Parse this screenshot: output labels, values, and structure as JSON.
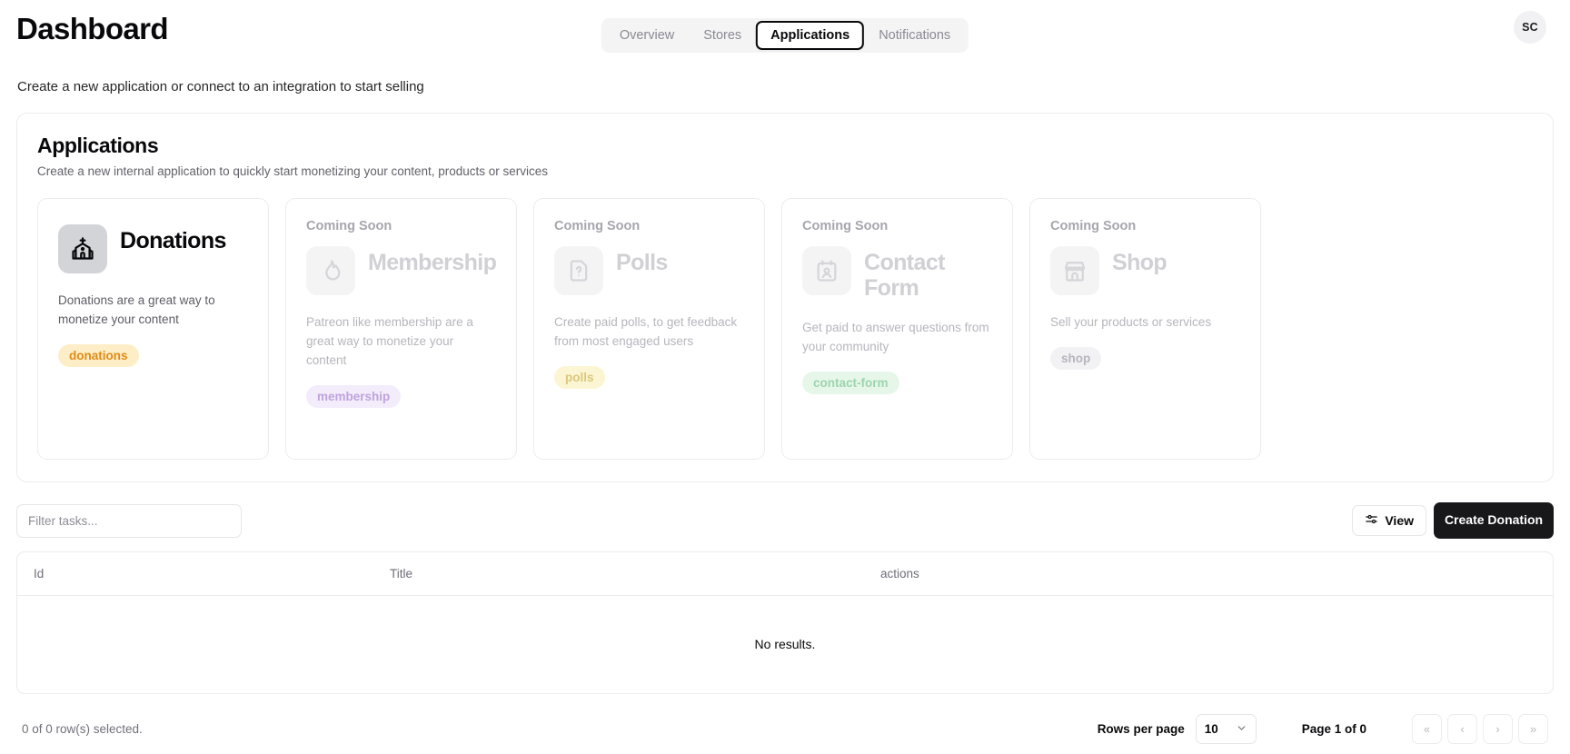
{
  "header": {
    "title": "Dashboard",
    "avatar_initials": "SC",
    "tabs": [
      {
        "label": "Overview",
        "active": false
      },
      {
        "label": "Stores",
        "active": false
      },
      {
        "label": "Applications",
        "active": true
      },
      {
        "label": "Notifications",
        "active": false
      }
    ]
  },
  "subtitle": "Create a new application or connect to an integration to start selling",
  "panel": {
    "title": "Applications",
    "description": "Create a new internal application to quickly start monetizing your content, products or services",
    "coming_soon_label": "Coming Soon",
    "cards": [
      {
        "name": "Donations",
        "icon": "church-icon",
        "description": "Donations are a great way to monetize your content",
        "badge": "donations",
        "badge_bg": "#fdeec8",
        "badge_fg": "#e08b16",
        "tile_bg": "#d3d4d8",
        "coming_soon": false
      },
      {
        "name": "Membership",
        "icon": "flame-icon",
        "description": "Patreon like membership are a great way to monetize your content",
        "badge": "membership",
        "badge_bg": "#f3ecfb",
        "badge_fg": "#c0a3dd",
        "tile_bg": "#f4f4f5",
        "coming_soon": true
      },
      {
        "name": "Polls",
        "icon": "file-question-icon",
        "description": "Create paid polls, to get feedback from most engaged users",
        "badge": "polls",
        "badge_bg": "#fbf5d3",
        "badge_fg": "#dcc77a",
        "tile_bg": "#f4f4f5",
        "coming_soon": true
      },
      {
        "name": "Contact Form",
        "icon": "contact-card-icon",
        "description": "Get paid to answer questions from your community",
        "badge": "contact-form",
        "badge_bg": "#e6f7ea",
        "badge_fg": "#9dd4ae",
        "tile_bg": "#f4f4f5",
        "coming_soon": true
      },
      {
        "name": "Shop",
        "icon": "store-icon",
        "description": "Sell your products or services",
        "badge": "shop",
        "badge_bg": "#f2f2f4",
        "badge_fg": "#b5b5bd",
        "tile_bg": "#f4f4f5",
        "coming_soon": true
      }
    ]
  },
  "toolbar": {
    "filter_placeholder": "Filter tasks...",
    "filter_value": "",
    "view_label": "View",
    "view_icon": "sliders-icon",
    "create_label": "Create Donation"
  },
  "table": {
    "columns": [
      "Id",
      "Title",
      "actions"
    ],
    "rows": [],
    "empty_message": "No results."
  },
  "footer": {
    "rows_selected": "0 of 0 row(s) selected.",
    "rows_per_page_label": "Rows per page",
    "rows_per_page_value": "10",
    "page_indicator": "Page 1 of 0",
    "pager": [
      {
        "name": "first-page-button",
        "glyph": "«"
      },
      {
        "name": "previous-page-button",
        "glyph": "‹"
      },
      {
        "name": "next-page-button",
        "glyph": "›"
      },
      {
        "name": "last-page-button",
        "glyph": "»"
      }
    ]
  }
}
